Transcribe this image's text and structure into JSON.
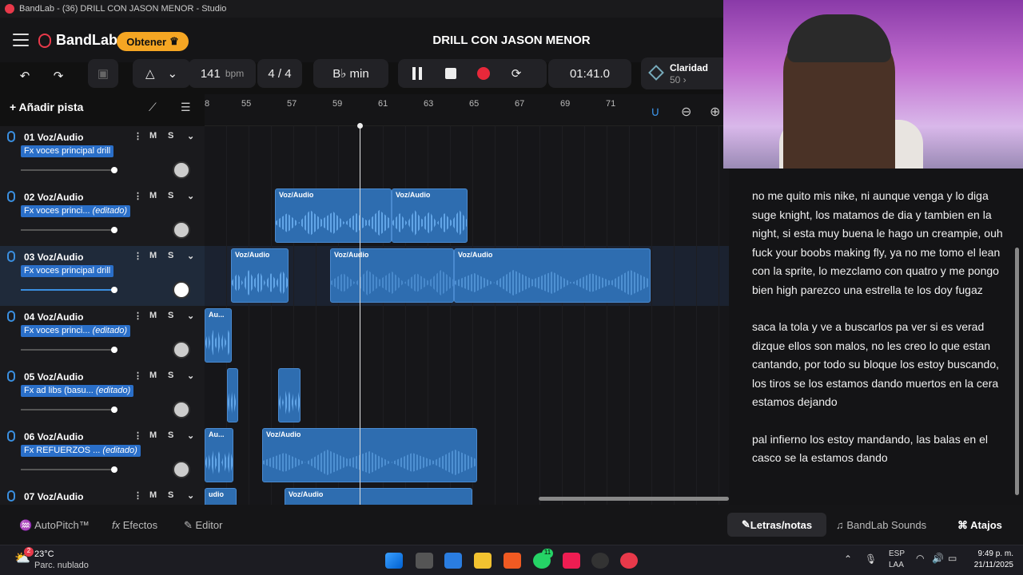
{
  "window": {
    "title": "BandLab - (36) DRILL CON JASON MENOR - Studio"
  },
  "header": {
    "brand": "BandLab",
    "obtener": "Obtener",
    "song_title": "DRILL CON JASON MENOR"
  },
  "toolbar": {
    "bpm_value": "141",
    "bpm_unit": "bpm",
    "time_sig": "4 / 4",
    "key": "B♭ min",
    "time": "01:41.0",
    "clarity_label": "Claridad",
    "clarity_value": "50 ›"
  },
  "add_track": "+ Añadir pista",
  "ruler": [
    "8",
    "55",
    "57",
    "59",
    "61",
    "63",
    "65",
    "67",
    "69",
    "71"
  ],
  "tracks": [
    {
      "name": "01  Voz/Audio",
      "fx": "Fx voces principal drill",
      "edited": ""
    },
    {
      "name": "02  Voz/Audio",
      "fx": "Fx voces princi...",
      "edited": "(editado)"
    },
    {
      "name": "03  Voz/Audio",
      "fx": "Fx voces principal drill",
      "edited": ""
    },
    {
      "name": "04  Voz/Audio",
      "fx": "Fx voces princi...",
      "edited": "(editado)"
    },
    {
      "name": "05  Voz/Audio",
      "fx": "Fx ad libs (basu...",
      "edited": "(editado)"
    },
    {
      "name": "06  Voz/Audio",
      "fx": "Fx REFUERZOS ...",
      "edited": "(editado)"
    },
    {
      "name": "07  Voz/Audio",
      "fx": "",
      "edited": ""
    }
  ],
  "mute_label": "M",
  "solo_label": "S",
  "clips": {
    "voz": "Voz/Audio",
    "au": "Au...",
    "udio": "udio"
  },
  "bottom": {
    "autopitch": "AutoPitch™",
    "efectos": "Efectos",
    "editor": "Editor",
    "letras": "Letras/notas",
    "sounds": "BandLab Sounds",
    "atajos": "Atajos"
  },
  "lyrics": [
    "no me quito mis nike, ni aunque venga y lo diga suge knight, los matamos de dia y tambien en la night, si esta muy buena le hago un creampie, ouh fuck your boobs making fly, ya no me tomo el lean con la sprite, lo mezclamo con quatro y me pongo bien high parezco una estrella te los doy fugaz",
    "saca la tola y ve a buscarlos pa ver si es verad dizque ellos son malos, no les creo lo que estan cantando, por todo su bloque los estoy buscando, los tiros se los estamos dando muertos en la cera estamos dejando",
    "pal infierno los estoy mandando, las balas en el casco se la estamos dando"
  ],
  "taskbar": {
    "weather_temp": "23°C",
    "weather_desc": "Parc. nublado",
    "lang1": "ESP",
    "lang2": "LAA",
    "clock_time": "9:49 p. m.",
    "clock_date": "21/11/2025",
    "badge": "2",
    "wa_badge": "11"
  },
  "colors": {
    "accent": "#e8394a",
    "clip": "#2e6db0",
    "obtener": "#f5a623"
  }
}
